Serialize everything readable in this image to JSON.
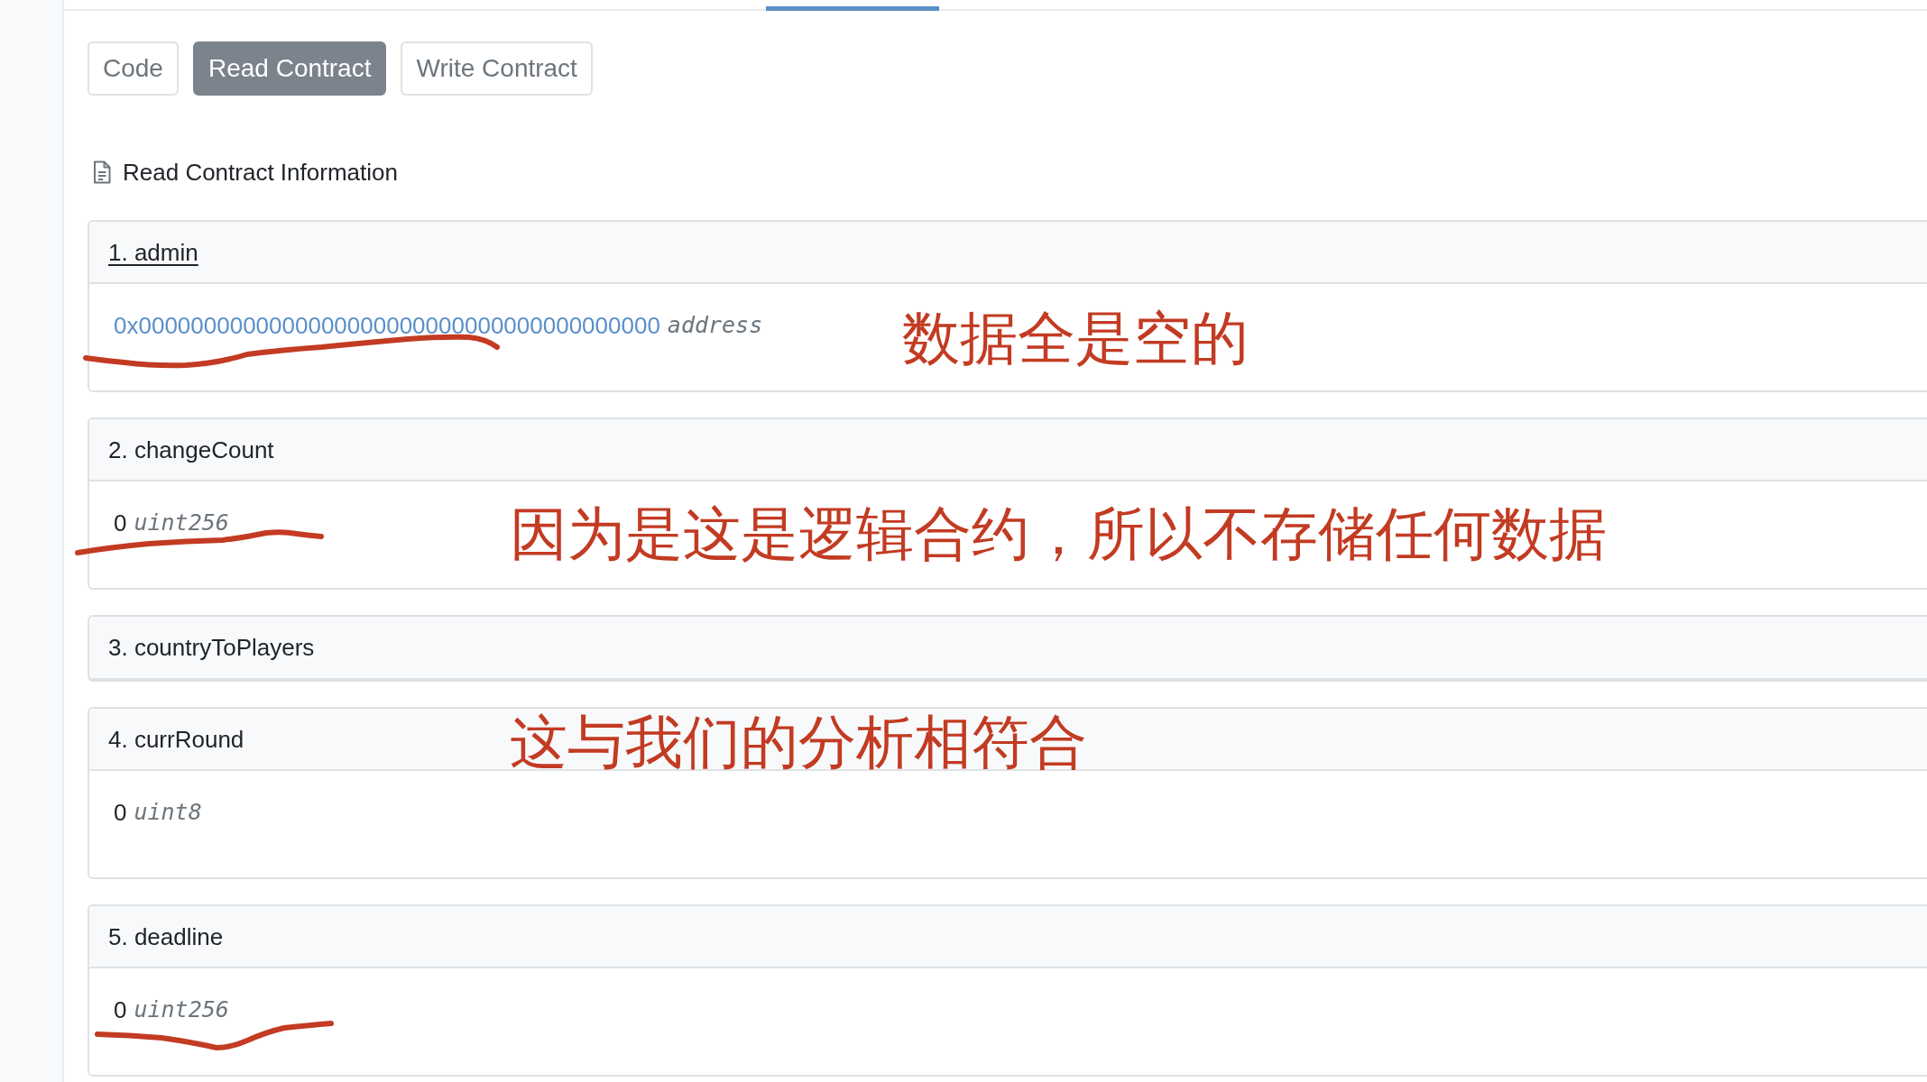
{
  "tabs": [
    {
      "label": "Code",
      "selected": false
    },
    {
      "label": "Read Contract",
      "selected": true
    },
    {
      "label": "Write Contract",
      "selected": false
    }
  ],
  "section": {
    "title": "Read Contract Information"
  },
  "functions": [
    {
      "name": "1. admin",
      "hovered": true,
      "expanded": true,
      "result": {
        "kind": "link",
        "value": "0x0000000000000000000000000000000000000000",
        "type": "address"
      },
      "marked": true,
      "note": "数据全是空的"
    },
    {
      "name": "2. changeCount",
      "hovered": false,
      "expanded": true,
      "result": {
        "kind": "number",
        "value": "0",
        "type": "uint256"
      },
      "marked": true,
      "note": "因为是这是逻辑合约，所以不存储任何数据"
    },
    {
      "name": "3. countryToPlayers",
      "hovered": false,
      "expanded": false,
      "marked": false
    },
    {
      "name": "4. currRound",
      "hovered": false,
      "expanded": true,
      "result": {
        "kind": "number",
        "value": "0",
        "type": "uint8"
      },
      "marked": false,
      "note": "这与我们的分析相符合"
    },
    {
      "name": "5. deadline",
      "hovered": false,
      "expanded": true,
      "result": {
        "kind": "number",
        "value": "0",
        "type": "uint256"
      },
      "marked": true
    }
  ]
}
